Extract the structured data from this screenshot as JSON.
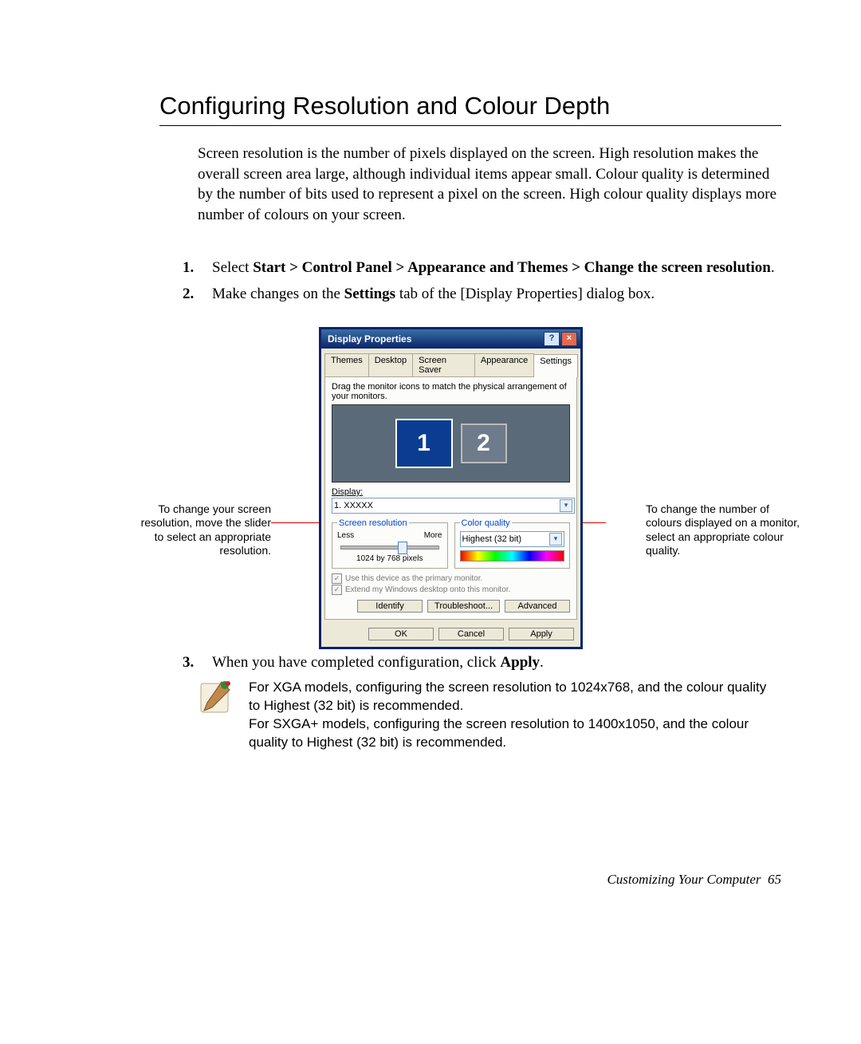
{
  "title": "Configuring Resolution and Colour Depth",
  "intro": "Screen resolution is the number of pixels displayed on the screen. High resolution makes the overall screen area large, although individual items appear small. Colour quality is determined by the number of bits used to represent a pixel on the screen. High colour quality displays more number of colours on your screen.",
  "steps": {
    "s1_lead": "Select ",
    "s1_bold": "Start > Control Panel > Appearance and Themes > Change the screen resolution",
    "s1_tail": ".",
    "s2_a": "Make changes on the ",
    "s2_bold1": "Settings",
    "s2_b": " tab of the [Display Properties] dialog box.",
    "s3_a": "When you have completed configuration, click ",
    "s3_bold": "Apply",
    "s3_b": "."
  },
  "callouts": {
    "left": "To change your screen resolution, move the slider to select an appropriate resolution.",
    "right": "To change the number of colours displayed on a monitor, select an appropriate colour quality."
  },
  "dialog": {
    "title": "Display Properties",
    "help": "?",
    "close": "×",
    "tabs": [
      "Themes",
      "Desktop",
      "Screen Saver",
      "Appearance",
      "Settings"
    ],
    "active_tab_index": 4,
    "instruction": "Drag the monitor icons to match the physical arrangement of your monitors.",
    "monitors": {
      "m1": "1",
      "m2": "2"
    },
    "display_label": "Display:",
    "display_value": "1. XXXXX",
    "res_group": "Screen resolution",
    "res_less": "Less",
    "res_more": "More",
    "res_readout": "1024 by 768 pixels",
    "color_group": "Color quality",
    "color_value": "Highest (32 bit)",
    "chk1": "Use this device as the primary monitor.",
    "chk2": "Extend my Windows desktop onto this monitor.",
    "btn_identify": "Identify",
    "btn_trouble": "Troubleshoot...",
    "btn_adv": "Advanced",
    "btn_ok": "OK",
    "btn_cancel": "Cancel",
    "btn_apply": "Apply"
  },
  "note": {
    "p1": "For XGA models, configuring the screen resolution to 1024x768, and the colour quality to Highest (32 bit) is recommended.",
    "p2": "For SXGA+ models, configuring the screen resolution to 1400x1050, and the colour quality to Highest (32 bit) is recommended."
  },
  "footer": {
    "section": "Customizing Your Computer",
    "page": "65"
  }
}
